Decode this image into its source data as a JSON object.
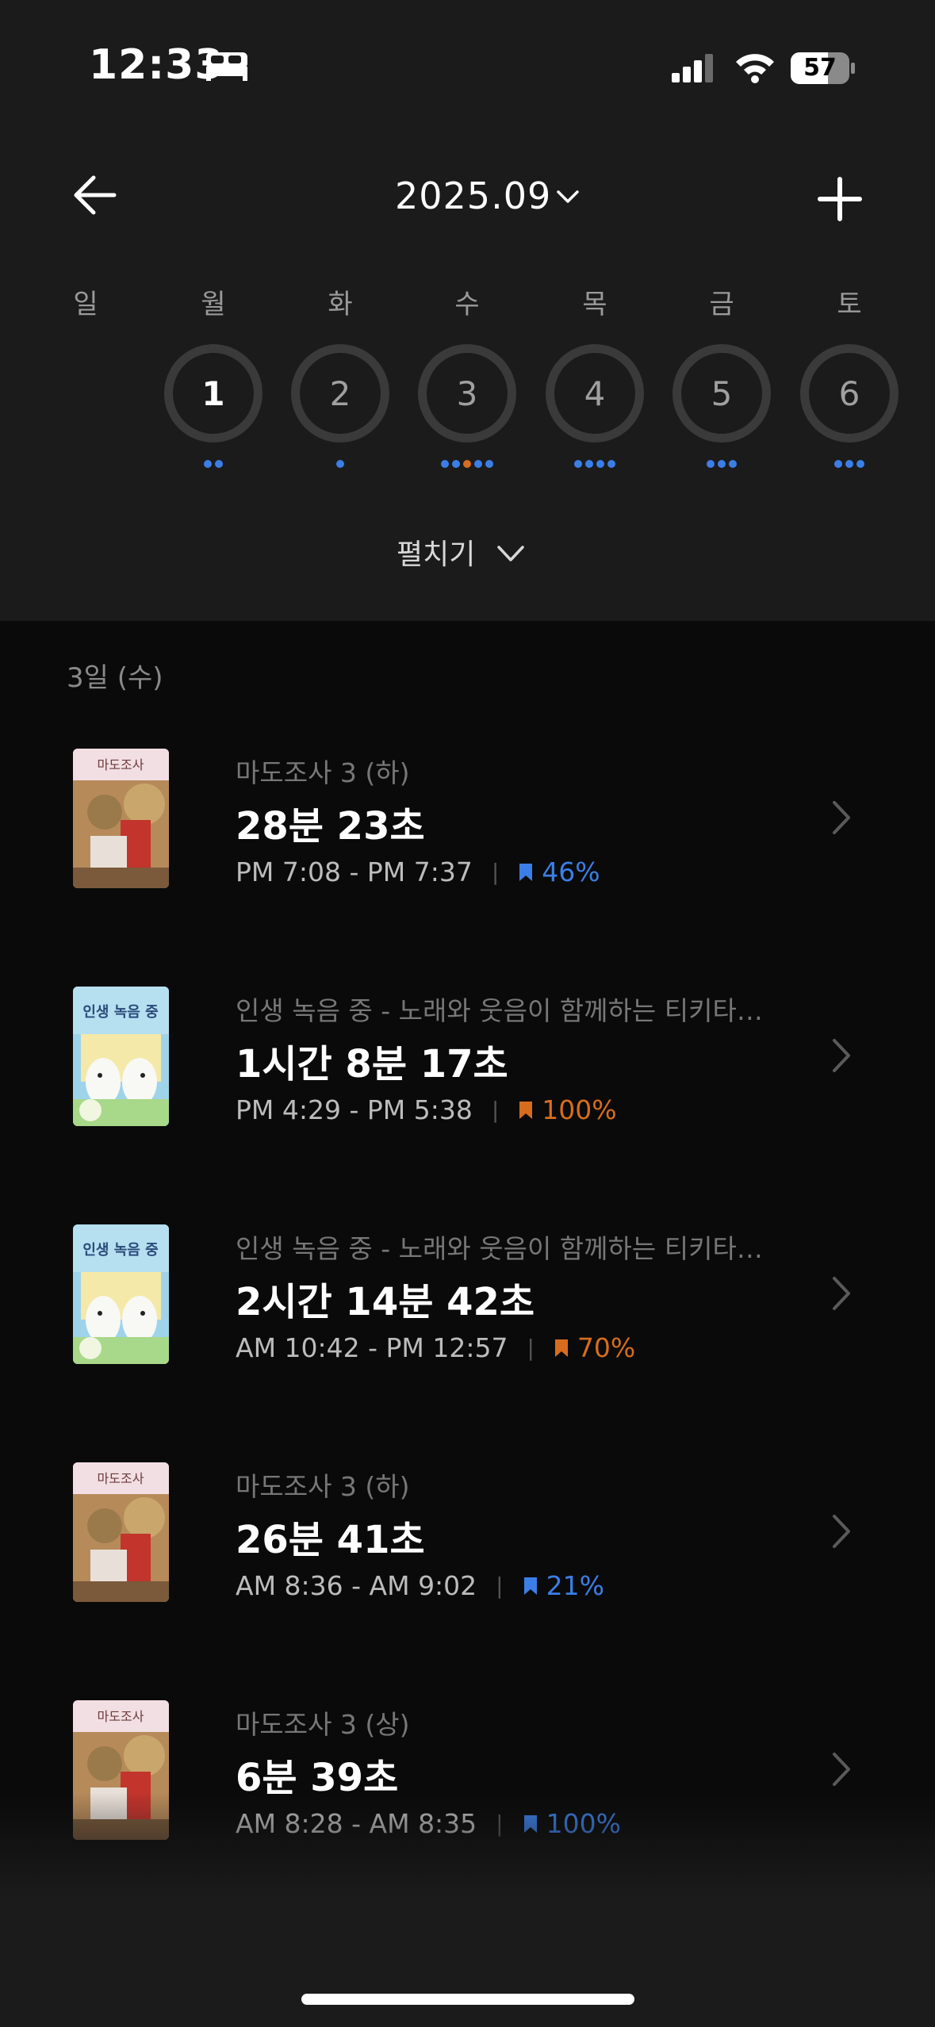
{
  "status_bar": {
    "time": "12:33",
    "battery": "57",
    "icons": [
      "sleep-icon",
      "signal-icon",
      "wifi-icon",
      "battery-icon"
    ]
  },
  "header": {
    "title": "2025.09",
    "back_icon": "arrow-left-icon",
    "add_icon": "plus-icon"
  },
  "weekdays": [
    "일",
    "월",
    "화",
    "수",
    "목",
    "금",
    "토"
  ],
  "days": [
    {
      "label": "1",
      "dots": [
        "#3b7ee6",
        "#3b7ee6"
      ]
    },
    {
      "label": "2",
      "dots": [
        "#3b7ee6"
      ]
    },
    {
      "label": "3",
      "dots": [
        "#3b7ee6",
        "#3b7ee6",
        "#d76d1c",
        "#3b7ee6",
        "#3b7ee6"
      ]
    },
    {
      "label": "4",
      "dots": [
        "#3b7ee6",
        "#3b7ee6",
        "#3b7ee6",
        "#3b7ee6"
      ]
    },
    {
      "label": "5",
      "dots": [
        "#3b7ee6",
        "#3b7ee6",
        "#3b7ee6"
      ]
    },
    {
      "label": "6",
      "dots": [
        "#3b7ee6",
        "#3b7ee6",
        "#3b7ee6"
      ]
    }
  ],
  "selected_day": "1",
  "expand_label": "펼치기",
  "list": {
    "date_label": "3일 (수)",
    "items": [
      {
        "book": "마도조사 3 (하)",
        "duration": "28분 23초",
        "time_range": "PM 7:08 - PM 7:37",
        "progress": "46%",
        "color": "blue",
        "cover": "modo"
      },
      {
        "book": "인생 녹음 중 - 노래와 웃음이 함께하는 티키타…",
        "duration": "1시간 8분 17초",
        "time_range": "PM 4:29 - PM 5:38",
        "progress": "100%",
        "color": "orange",
        "cover": "insaeng"
      },
      {
        "book": "인생 녹음 중 - 노래와 웃음이 함께하는 티키타…",
        "duration": "2시간 14분 42초",
        "time_range": "AM 10:42 - PM 12:57",
        "progress": "70%",
        "color": "orange",
        "cover": "insaeng"
      },
      {
        "book": "마도조사 3 (하)",
        "duration": "26분 41초",
        "time_range": "AM 8:36 - AM 9:02",
        "progress": "21%",
        "color": "blue",
        "cover": "modo"
      },
      {
        "book": "마도조사 3 (상)",
        "duration": "6분 39초",
        "time_range": "AM 8:28 - AM 8:35",
        "progress": "100%",
        "color": "blue",
        "cover": "modo"
      }
    ]
  },
  "colors": {
    "accent_blue": "#3b7ee6",
    "accent_orange": "#d76d1c",
    "background": "#0a0a0a",
    "header_bg": "#1b1b1c"
  }
}
